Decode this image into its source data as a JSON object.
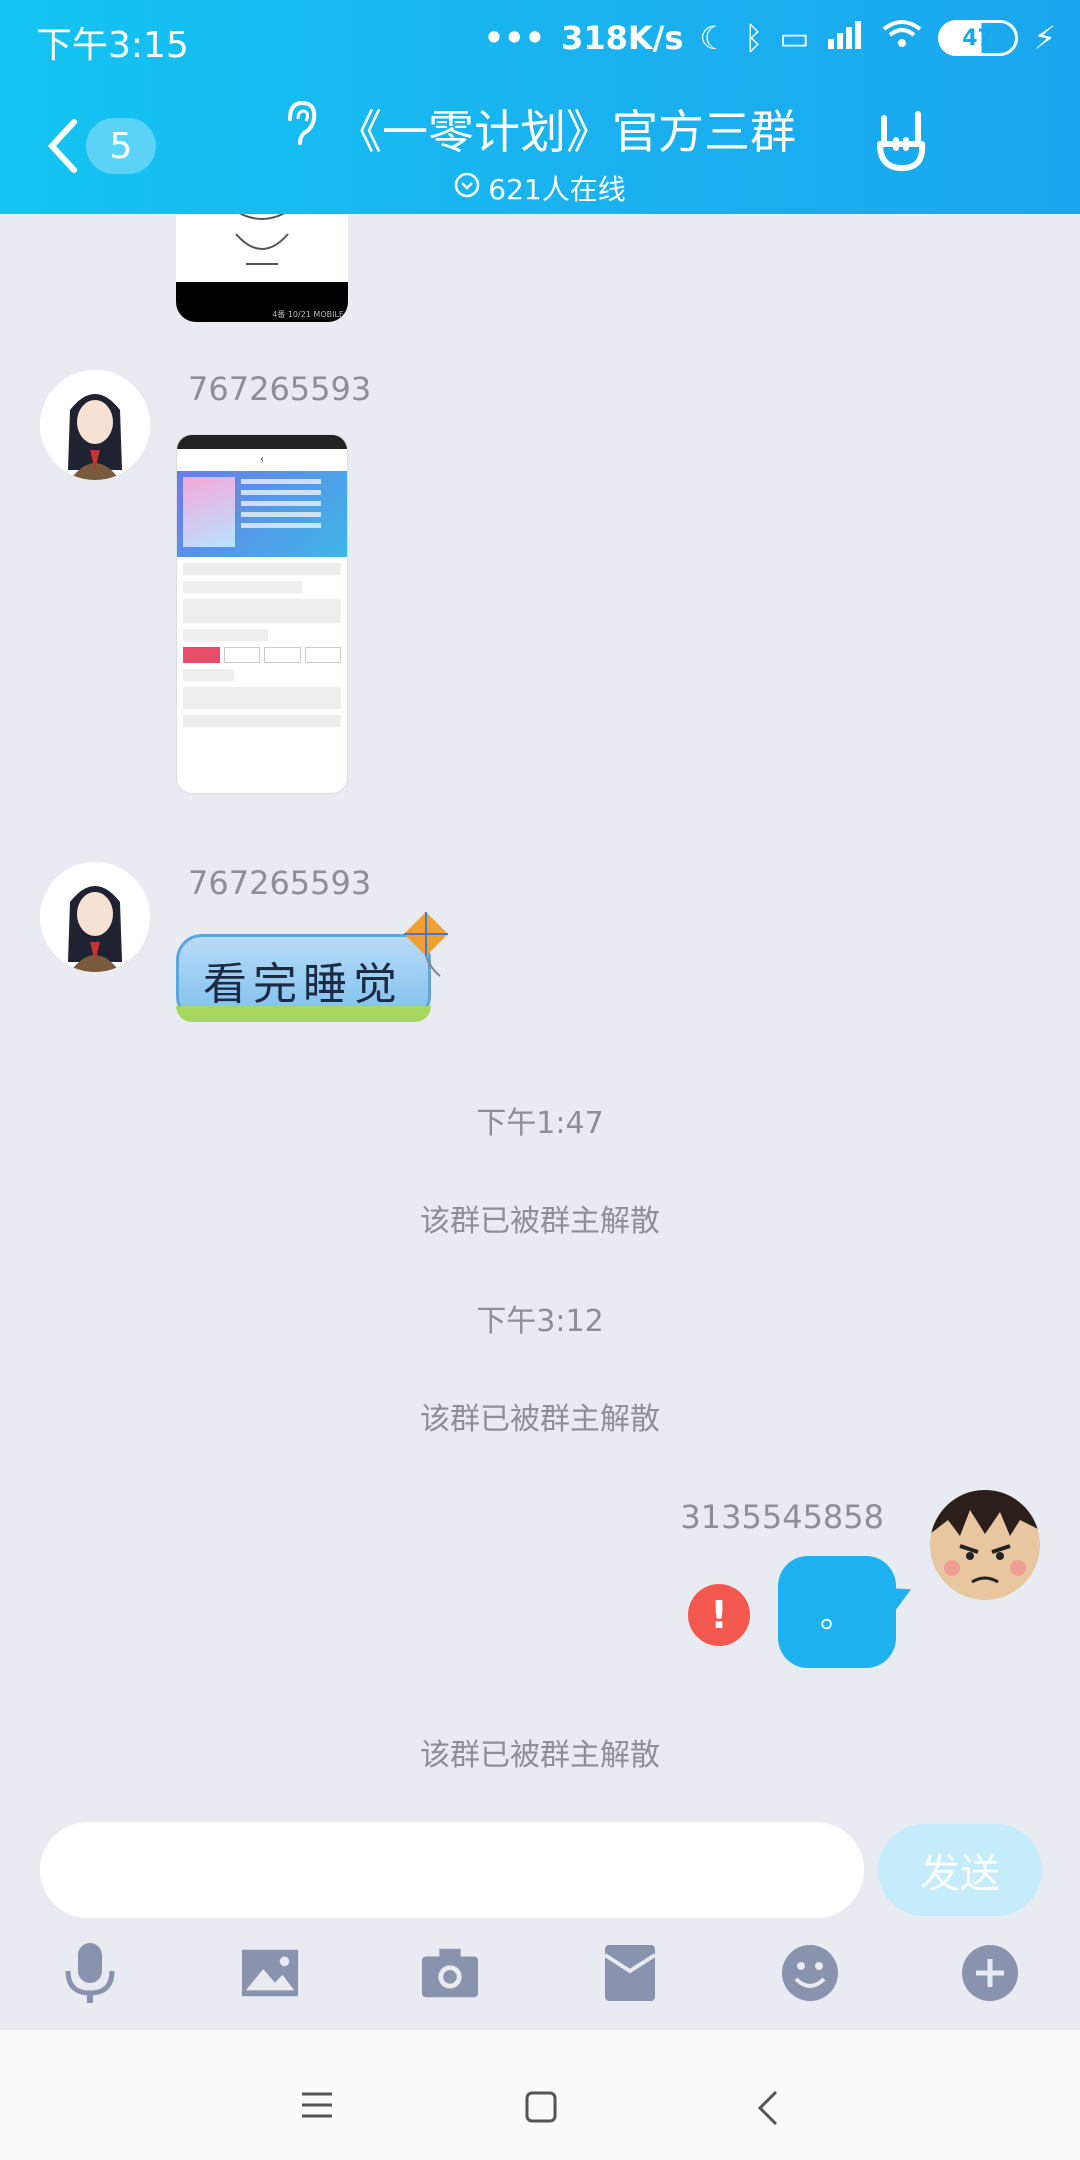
{
  "status_bar": {
    "time": "下午3:15",
    "net_speed": "318K/s",
    "battery": "47"
  },
  "header": {
    "back_count": "5",
    "title": "《一零计划》官方三群",
    "online": "621人在线"
  },
  "messages": [
    {
      "nick": "767265593",
      "type": "image"
    },
    {
      "nick": "767265593",
      "type": "sticker",
      "sticker_text": "看完睡觉"
    }
  ],
  "system": [
    {
      "text": "下午1:47"
    },
    {
      "text": "该群已被群主解散"
    },
    {
      "text": "下午3:12"
    },
    {
      "text": "该群已被群主解散"
    },
    {
      "text": "该群已被群主解散"
    }
  ],
  "my_message": {
    "nick": "3135545858",
    "text": "。",
    "error_mark": "!"
  },
  "input": {
    "placeholder": "",
    "send_label": "发送"
  },
  "image_watermark": "4番 10/21 MOBILE",
  "colors": {
    "header": "#1ab2f0",
    "my_bubble": "#1fb2f1",
    "error": "#f2584d",
    "send_disabled": "#c4ecfb"
  }
}
